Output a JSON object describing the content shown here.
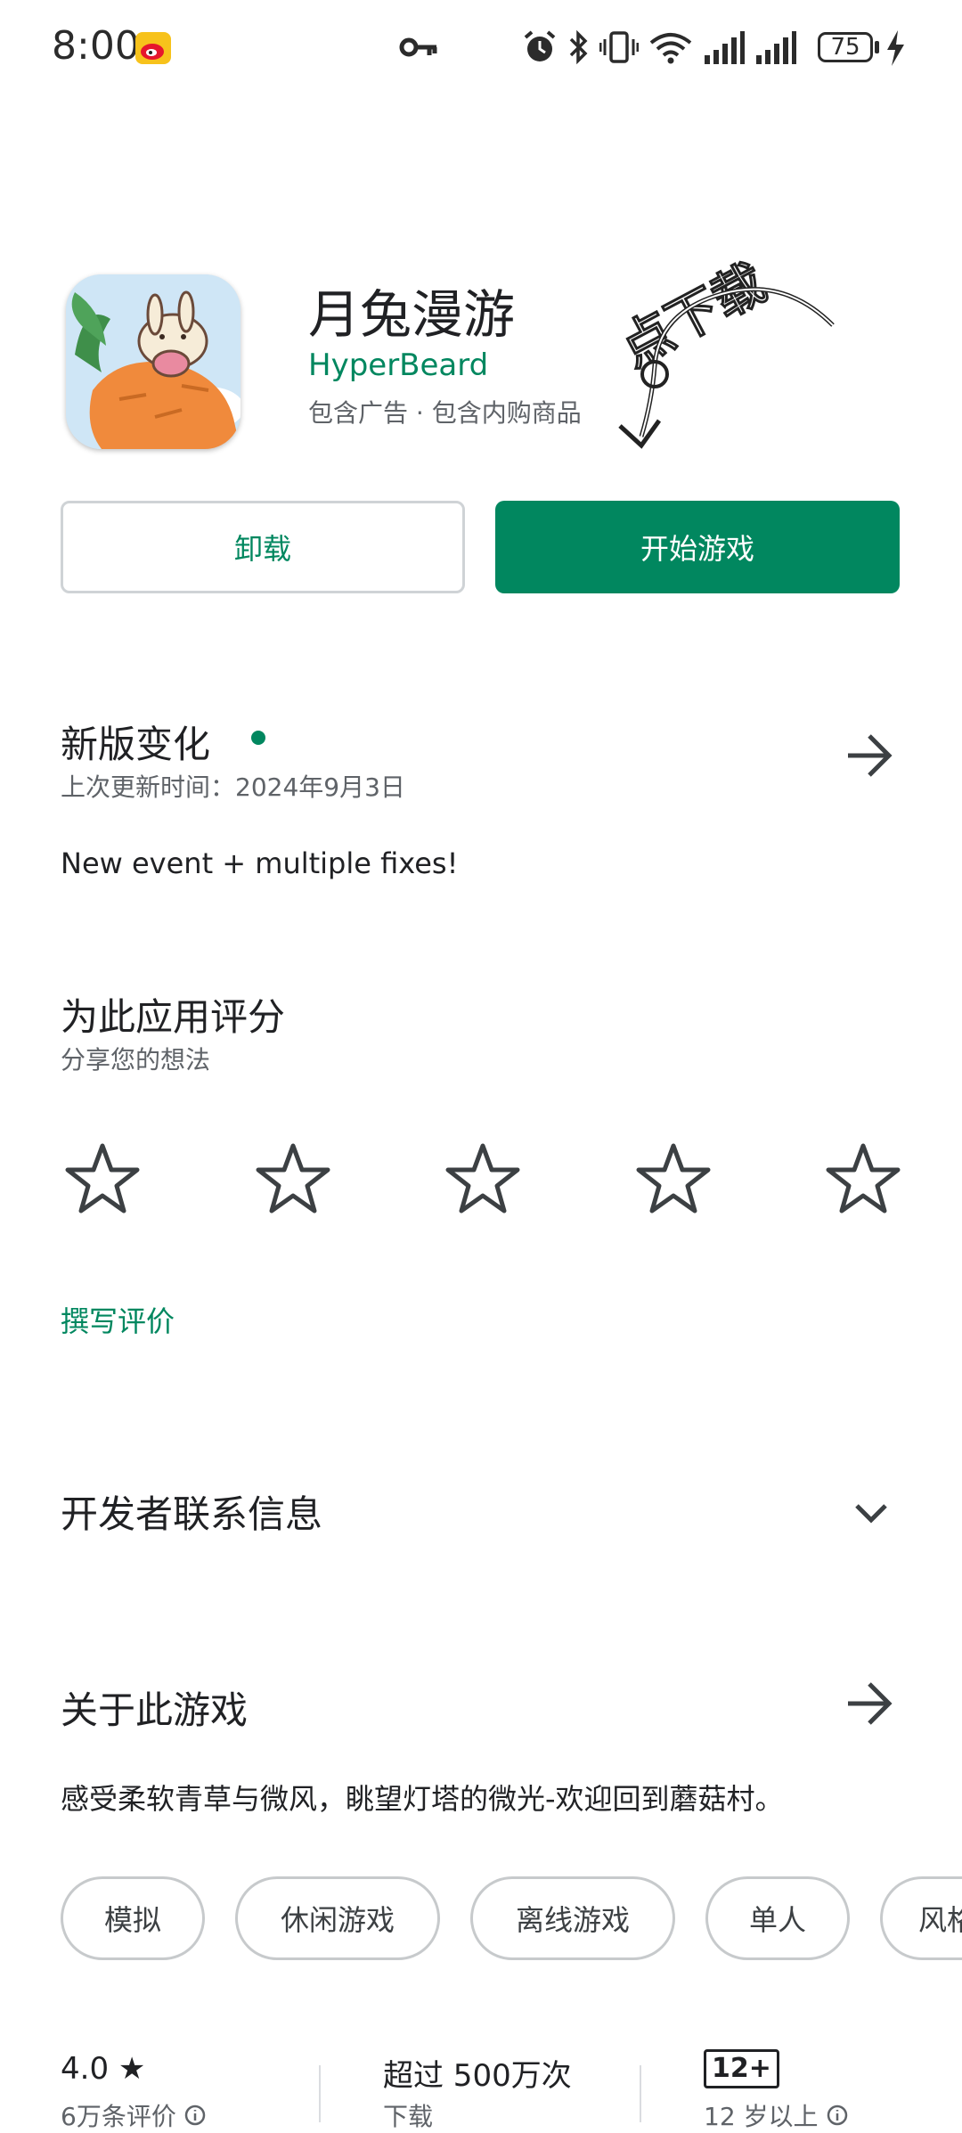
{
  "status_bar": {
    "time": "8:00",
    "battery": "75",
    "icons": [
      "weibo-icon",
      "vpn-key-icon",
      "alarm-icon",
      "bluetooth-icon",
      "vibrate-icon",
      "wifi-icon",
      "signal-icon",
      "signal-icon",
      "charging-icon"
    ]
  },
  "app": {
    "title": "月兔漫游",
    "developer": "HyperBeard",
    "meta": "包含广告 · 包含内购商品",
    "annotation": "点下载"
  },
  "buttons": {
    "uninstall": "卸载",
    "play": "开始游戏"
  },
  "whats_new": {
    "title": "新版变化",
    "updated": "上次更新时间：2024年9月3日",
    "notes": "New event + multiple fixes!"
  },
  "rate": {
    "title": "为此应用评分",
    "subtitle": "分享您的想法",
    "stars": 5,
    "write_review": "撰写评价"
  },
  "developer_contact": {
    "title": "开发者联系信息"
  },
  "about": {
    "title": "关于此游戏",
    "description": "感受柔软青草与微风，眺望灯塔的微光-欢迎回到蘑菇村。",
    "tags": [
      "模拟",
      "休闲游戏",
      "离线游戏",
      "单人",
      "风格"
    ]
  },
  "stats": {
    "rating_value": "4.0 ★",
    "rating_label": "6万条评价",
    "downloads_value": "超过 500万次",
    "downloads_label": "下载",
    "age_badge": "12+",
    "age_label": "12 岁以上"
  },
  "colors": {
    "accent": "#01875f",
    "text": "#202124",
    "secondary": "#5f6368"
  }
}
